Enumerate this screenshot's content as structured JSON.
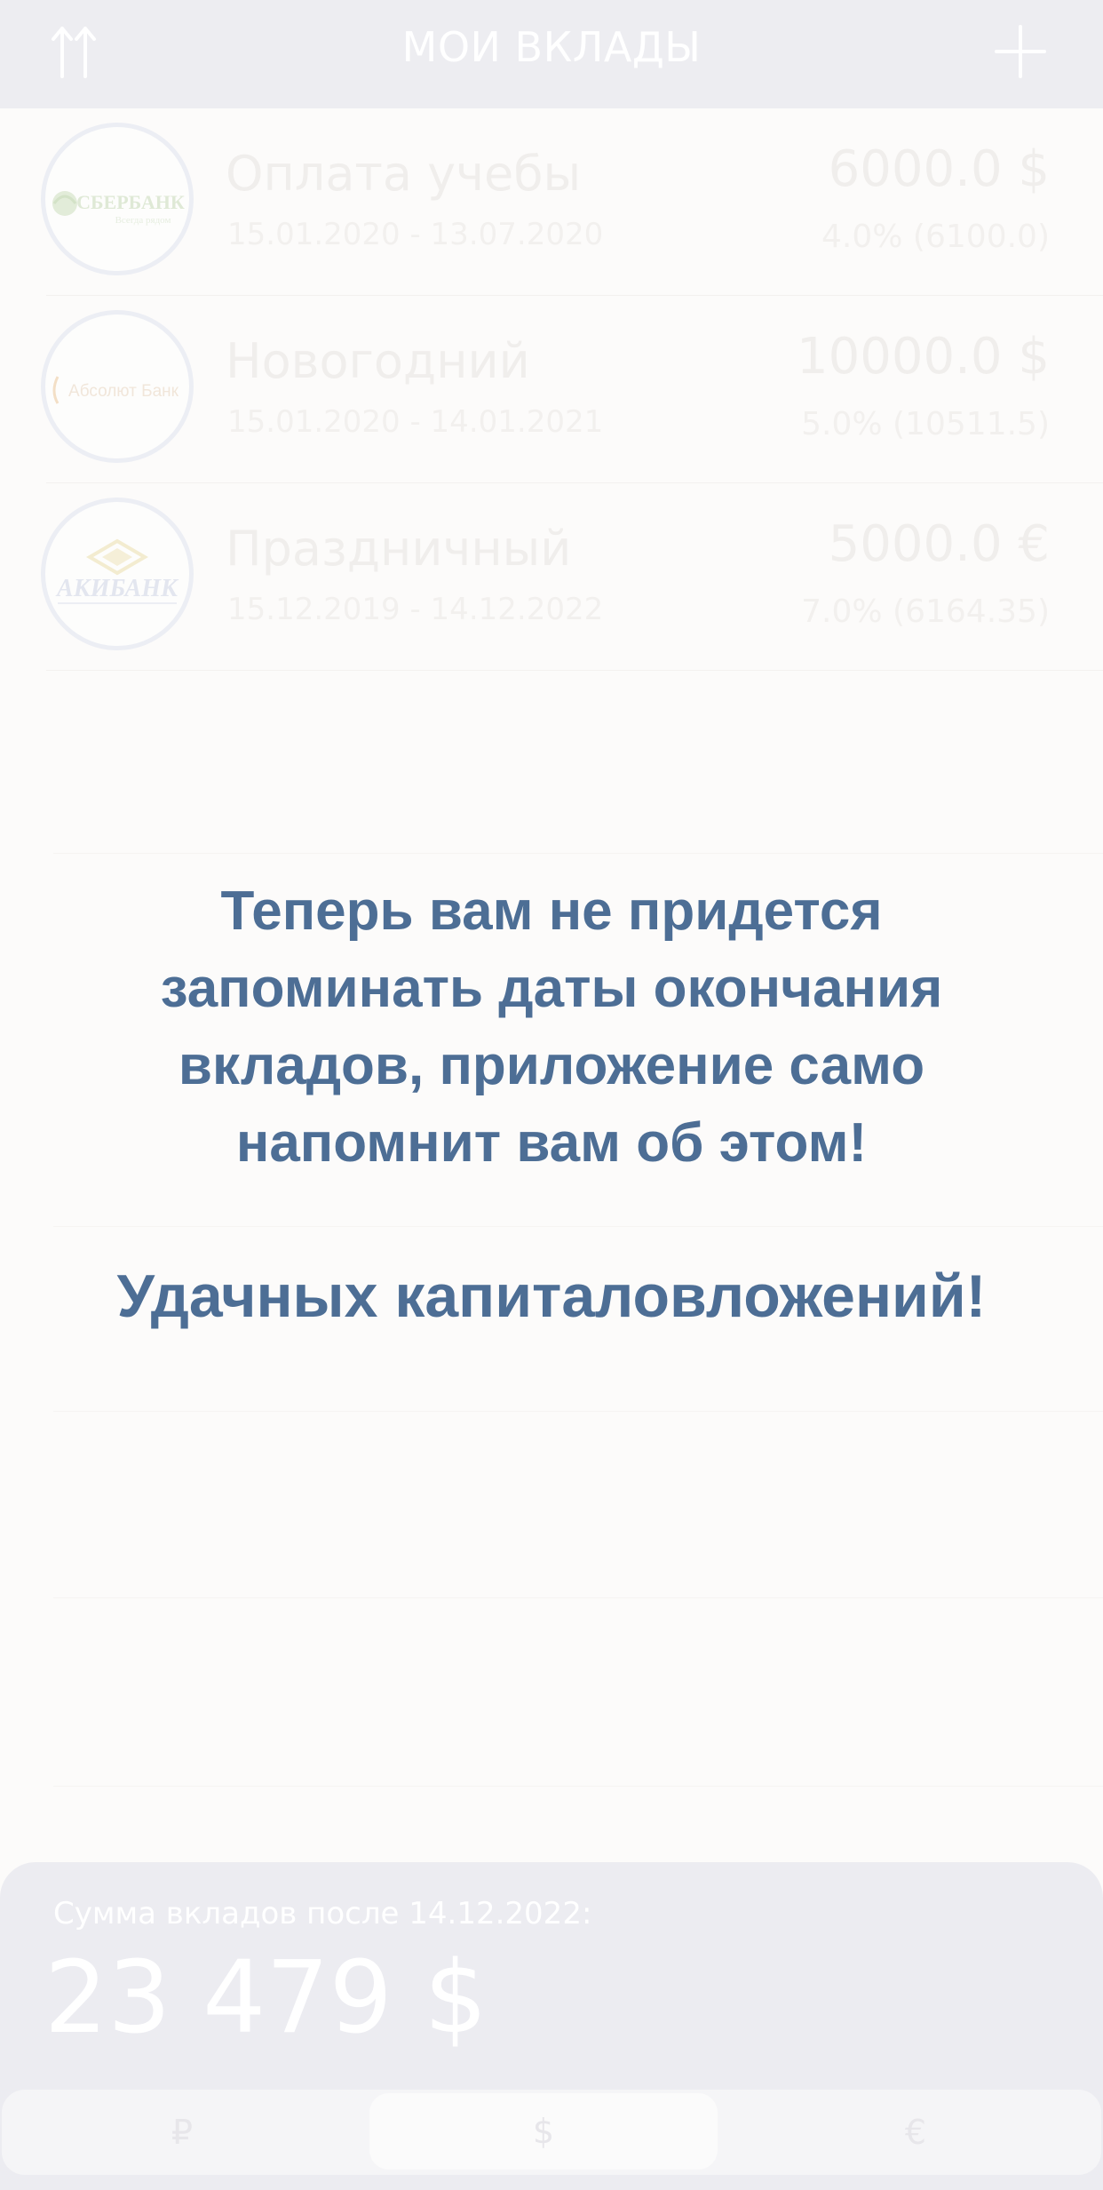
{
  "header": {
    "title": "МОИ ВКЛАДЫ",
    "sort_icon": "sort-arrows-icon",
    "add_icon": "plus-icon"
  },
  "deposits": [
    {
      "bank_logo_text": "СБЕРБАНК",
      "bank_logo_sub": "Всегда рядом",
      "name": "Оплата учебы",
      "dates": "15.01.2020 - 13.07.2020",
      "amount": "6000.0 $",
      "rate": "4.0% (6100.0)"
    },
    {
      "bank_logo_text": "Абсолют Банк",
      "name": "Новогодний",
      "dates": "15.01.2020 - 14.01.2021",
      "amount": "10000.0 $",
      "rate": "5.0% (10511.5)"
    },
    {
      "bank_logo_text": "АКИБАНК",
      "name": "Праздничный",
      "dates": "15.12.2019 - 14.12.2022",
      "amount": "5000.0 €",
      "rate": "7.0% (6164.35)"
    }
  ],
  "overlay": {
    "message": "Теперь вам не придется запоминать даты окончания вкладов, приложение само напомнит вам об этом!",
    "wish": "Удачных капиталовложений!"
  },
  "summary": {
    "label": "Сумма вкладов после 14.12.2022:",
    "value": "23 479 $"
  },
  "currencies": [
    {
      "label": "₽",
      "selected": false
    },
    {
      "label": "$",
      "selected": true
    },
    {
      "label": "€",
      "selected": false
    }
  ],
  "colors": {
    "header_bg": "#ededf1",
    "message_text": "#4d6e95",
    "page_bg": "#fcfbfa"
  }
}
